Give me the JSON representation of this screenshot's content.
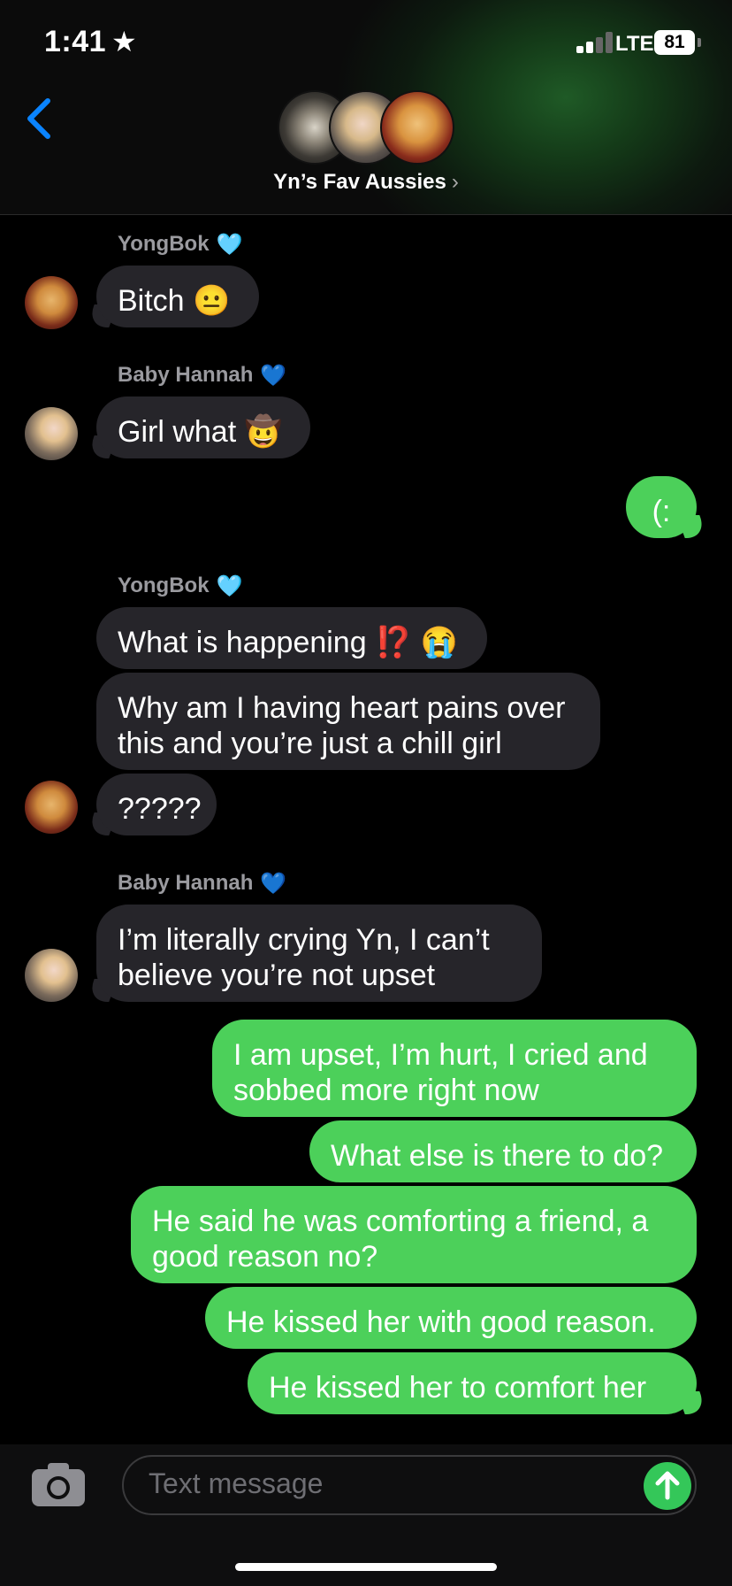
{
  "status_bar": {
    "time": "1:41",
    "network": "LTE",
    "battery": "81"
  },
  "header": {
    "group_name": "Yn’s Fav Aussies"
  },
  "messages": [
    {
      "sender": "YongBok",
      "heart": "🩵",
      "text": "Bitch 😐"
    },
    {
      "sender": "Baby Hannah",
      "heart": "💙",
      "text": "Girl what 🤠"
    },
    {
      "text": "(:"
    },
    {
      "sender": "YongBok",
      "heart": "🩵",
      "text": "What is happening ⁉️ 😭"
    },
    {
      "line1": "Why am I having heart pains over",
      "line2": "this and you’re just a chill girl"
    },
    {
      "text": "?????"
    },
    {
      "sender": "Baby Hannah",
      "heart": "💙",
      "line1": "I’m literally crying Yn, I can’t",
      "line2": "believe you’re not upset"
    },
    {
      "line1": "I am upset, I’m hurt, I cried and",
      "line2": "sobbed more right now"
    },
    {
      "text": "What else is there to do?"
    },
    {
      "line1": "He said he was comforting a friend, a",
      "line2": "good reason no?"
    },
    {
      "text": "He kissed her with good reason."
    },
    {
      "text": "He kissed her to comfort her"
    }
  ],
  "composer": {
    "placeholder": "Text message"
  },
  "colors": {
    "outgoing": "#4cd05a",
    "incoming": "#26252a",
    "accent": "#0a84ff"
  }
}
